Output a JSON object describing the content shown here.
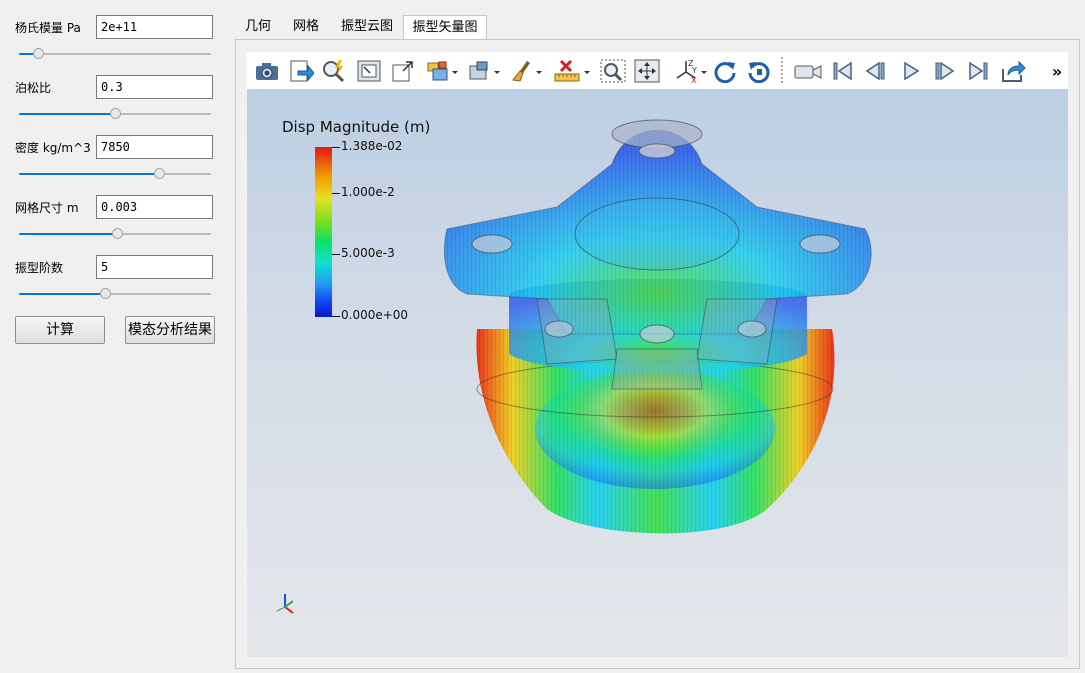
{
  "params": [
    {
      "label": "杨氏模量 Pa",
      "value": "2e+11",
      "slider": 0.1
    },
    {
      "label": "泊松比",
      "value": "0.3",
      "slider": 0.5
    },
    {
      "label": "密度 kg/m^3",
      "value": "7850",
      "slider": 0.73
    },
    {
      "label": "网格尺寸 m",
      "value": "0.003",
      "slider": 0.51
    },
    {
      "label": "振型阶数",
      "value": "5",
      "slider": 0.45
    }
  ],
  "buttons": {
    "compute": "计算",
    "modal_results": "模态分析结果"
  },
  "tabs": [
    {
      "label": "几何",
      "active": false
    },
    {
      "label": "网格",
      "active": false
    },
    {
      "label": "振型云图",
      "active": false
    },
    {
      "label": "振型矢量图",
      "active": true
    }
  ],
  "toolbar": {
    "items": [
      "camera-icon",
      "export-icon",
      "zoom-lightning-icon",
      "view-fit-icon",
      "view-corner-icon",
      "box-select-icon",
      "box-style-icon",
      "light-bulb-icon",
      "brush-icon",
      "ruler-delete-icon",
      "zoom-box-icon",
      "move-icon",
      "axes-icon",
      "rotate-cw-icon",
      "rotate-ccw-icon",
      "video-camera-icon",
      "first-frame-icon",
      "prev-frame-icon",
      "play-icon",
      "next-frame-icon",
      "last-frame-icon",
      "share-icon"
    ],
    "overflow": "»"
  },
  "legend": {
    "title": "Disp Magnitude (m)",
    "labels": [
      "1.388e-02",
      "1.000e-2",
      "5.000e-3",
      "0.000e+00"
    ]
  },
  "colors": {
    "accent": "#0078d7"
  }
}
